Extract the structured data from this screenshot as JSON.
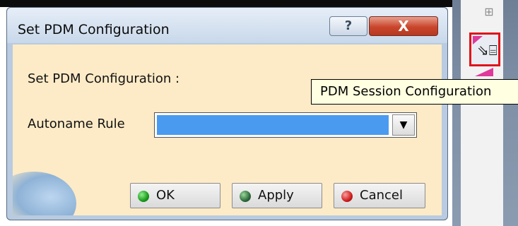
{
  "dialog": {
    "title": "Set PDM Configuration",
    "help_button": "?",
    "close_button": "X",
    "heading": "Set PDM Configuration :",
    "autoname_label": "Autoname Rule",
    "autoname_value": "",
    "buttons": {
      "ok": "OK",
      "apply": "Apply",
      "cancel": "Cancel"
    }
  },
  "toolbar": {
    "selected_icon": "pdm-session-configuration-icon"
  },
  "tooltip": {
    "text": "PDM Session Configuration"
  },
  "colors": {
    "dialog_body": "#fdebc7",
    "combo_highlight": "#4a9bf0",
    "selected_border": "#e0141b",
    "tooltip_bg": "#ffffe1"
  }
}
